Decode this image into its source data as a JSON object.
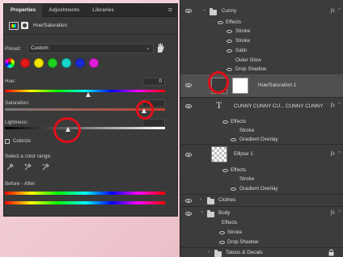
{
  "properties_panel": {
    "tabs": [
      "Properties",
      "Adjustments",
      "Libraries"
    ],
    "adjustment_title": "Hue/Saturation",
    "preset_label": "Preset:",
    "preset_value": "Custom",
    "hue_label": "Hue:",
    "hue_value": "0",
    "saturation_label": "Saturation:",
    "lightness_label": "Lightness:",
    "colorize_label": "Colorize",
    "select_color_range_label": "Select a color range:",
    "before_after_label": "Before - After:",
    "swatch_colors": [
      "#e21b1b",
      "#f2e600",
      "#1ed01e",
      "#16d6c8",
      "#1a2ad6",
      "#e01ed8"
    ],
    "annotation_color": "#e0101a"
  },
  "layers_panel": {
    "group_cunny": "Cunny",
    "effects_label": "Effects",
    "stroke_label": "Stroke",
    "satin_label": "Satin",
    "outer_glow_label": "Outer Glow",
    "drop_shadow_label": "Drop Shadow",
    "hue_sat_layer": "Hue/Saturation 1",
    "text_layer": "CUNNY CUNNY CU... CUNNY CUNNY",
    "gradient_overlay_label": "Gradient Overlay",
    "ellipse_layer": "Ellipse 1",
    "group_clothes": "Clothes",
    "group_body": "Body",
    "group_tatoos": "Tatoos & Decals",
    "fx_label": "fx"
  }
}
